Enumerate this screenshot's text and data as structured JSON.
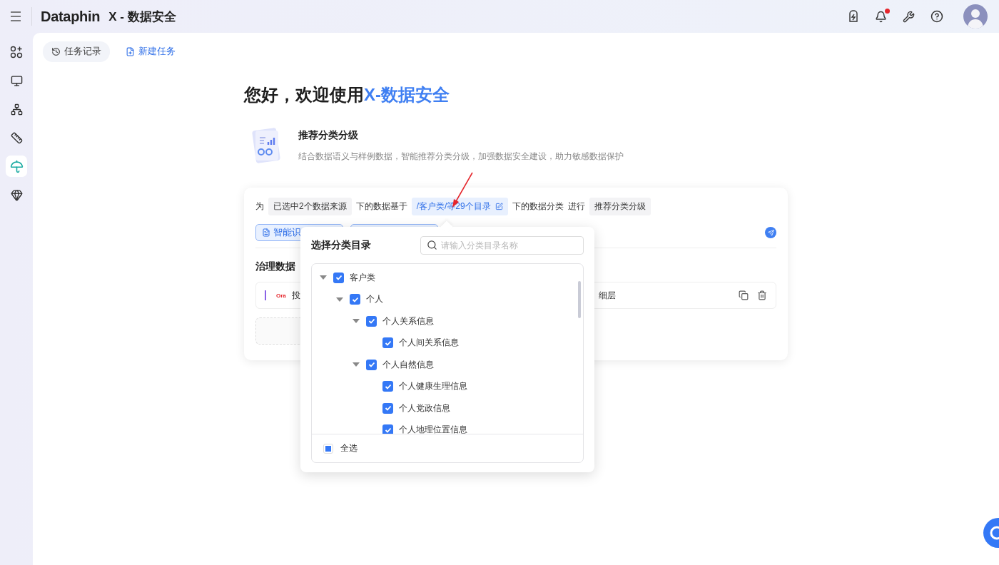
{
  "header": {
    "brand": "Dataphin",
    "title": "X - 数据安全",
    "notification_unread": true
  },
  "sidebar": {
    "items": [
      {
        "selected": false
      },
      {
        "selected": false
      },
      {
        "selected": false
      },
      {
        "selected": false
      },
      {
        "selected": true
      },
      {
        "selected": false
      }
    ]
  },
  "toolbar": [
    {
      "kind": "history",
      "label": "任务记录"
    },
    {
      "kind": "create",
      "label": "新建任务"
    }
  ],
  "welcome": {
    "greeting": "您好，欢迎使用",
    "product": "X-数据安全"
  },
  "feature": {
    "title": "推荐分类分级",
    "description": "结合数据语义与样例数据，智能推荐分类分级，加强数据安全建设，助力敏感数据保护"
  },
  "task": {
    "sentence": [
      {
        "kind": "text",
        "text": "为"
      },
      {
        "kind": "tag",
        "text": "已选中2个数据来源"
      },
      {
        "kind": "text",
        "text": "下的数据基于"
      },
      {
        "kind": "link",
        "text": "/客户类/等29个目录"
      },
      {
        "kind": "text",
        "text": "下的数据分类"
      },
      {
        "kind": "text",
        "text": "进行"
      },
      {
        "kind": "tag",
        "text": "推荐分类分级"
      }
    ],
    "chips": [
      {
        "kind": "labeled",
        "label": "智能识"
      },
      {
        "kind": "empty"
      }
    ],
    "section_title": "治理数据",
    "row": {
      "badge": "Ora",
      "name": "投",
      "layer": "细层"
    }
  },
  "popover": {
    "title": "选择分类目录",
    "search": {
      "placeholder": "请输入分类目录名称"
    },
    "tree": [
      {
        "label": "客户类",
        "checked": true,
        "expanded": true,
        "children": [
          {
            "label": "个人",
            "checked": true,
            "expanded": true,
            "children": [
              {
                "label": "个人关系信息",
                "checked": true,
                "expanded": true,
                "children": [
                  {
                    "label": "个人间关系信息",
                    "checked": true
                  }
                ]
              },
              {
                "label": "个人自然信息",
                "checked": true,
                "expanded": true,
                "children": [
                  {
                    "label": "个人健康生理信息",
                    "checked": true
                  },
                  {
                    "label": "个人党政信息",
                    "checked": true
                  },
                  {
                    "label": "个人地理位置信息",
                    "checked": true
                  }
                ]
              }
            ]
          }
        ]
      }
    ],
    "select_all": {
      "label": "全选",
      "indeterminate": true
    }
  }
}
